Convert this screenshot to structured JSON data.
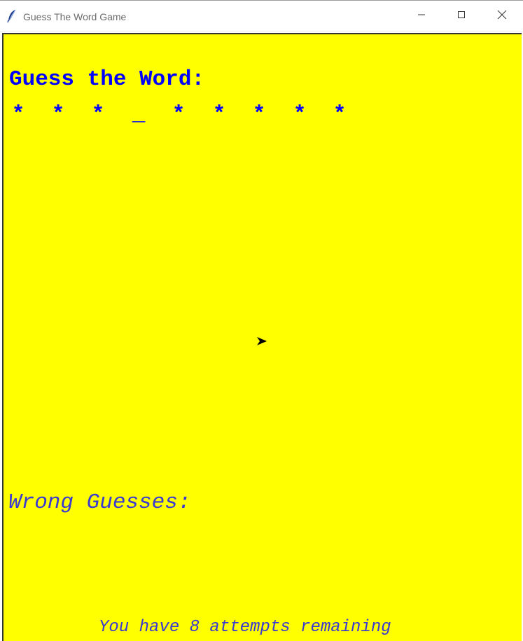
{
  "window": {
    "title": "Guess The Word Game",
    "icon": "feather-icon",
    "controls": [
      "minimize-icon",
      "maximize-icon",
      "close-icon"
    ]
  },
  "colors": {
    "background": "#ffff00",
    "heading": "#0000ff",
    "secondary": "#3a3ad0"
  },
  "game": {
    "heading": "Guess the Word:",
    "masked_word": [
      "*",
      "*",
      "*",
      "_",
      "*",
      "*",
      "*",
      "*",
      "*"
    ],
    "wrong_guesses_label": "Wrong Guesses:",
    "wrong_guesses": [],
    "attempts_remaining": 8,
    "attempts_text": "You have 8 attempts remaining"
  }
}
